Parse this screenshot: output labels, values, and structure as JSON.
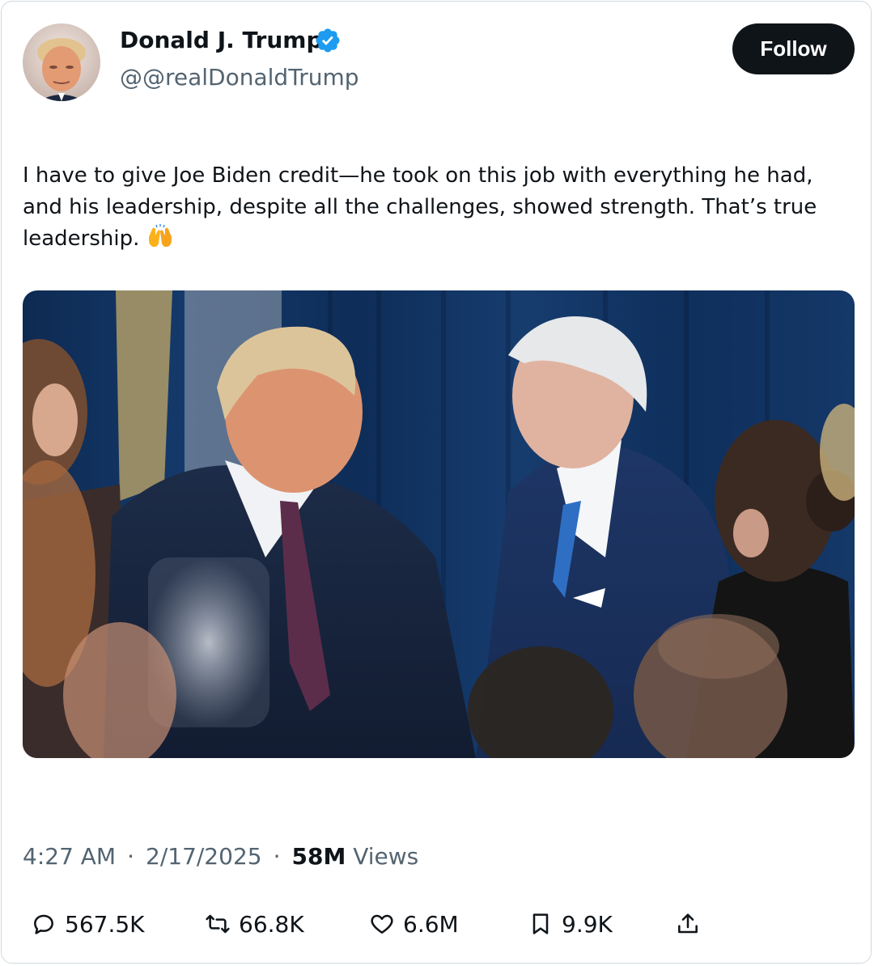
{
  "author": {
    "display_name": "Donald J. Trump",
    "handle": "@@realDonaldTrump",
    "verified": true
  },
  "follow_label": "Follow",
  "tweet": {
    "text": "I have to give Joe Biden credit—he took on this job with everything he had, and his leadership, despite all the challenges, showed strength. That’s true leadership.",
    "emoji": "raising-hands-emoji"
  },
  "meta": {
    "time": "4:27 AM",
    "separator": "·",
    "date": "2/17/2025",
    "views_count": "58M",
    "views_label": "Views"
  },
  "actions": {
    "reply": "567.5K",
    "repost": "66.8K",
    "like": "6.6M",
    "bookmark": "9.9K"
  },
  "colors": {
    "text": "#0f1419",
    "secondary": "#536471",
    "verified_blue": "#1d9bf0",
    "button_bg": "#0f1419",
    "border": "#cfd9de"
  }
}
